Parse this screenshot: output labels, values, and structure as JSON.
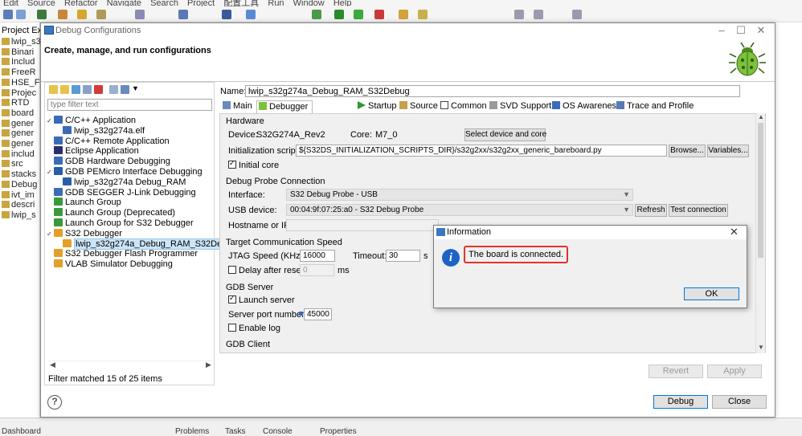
{
  "ide": {
    "menu": [
      "Edit",
      "Source",
      "Refactor",
      "Navigate",
      "Search",
      "Project",
      "配置工具",
      "Run",
      "Window",
      "Help"
    ],
    "project_explorer": {
      "title": "Project Exp",
      "items": [
        "lwip_s32g",
        "Binari",
        "Includ",
        "FreeR",
        "HSE_F",
        "Projec",
        "RTD",
        "board",
        "gener",
        "gener",
        "gener",
        "includ",
        "src",
        "stacks",
        "Debug",
        "ivt_im",
        "descri",
        "lwip_s"
      ]
    },
    "bottom_tabs": [
      "Dashboard",
      "Problems",
      "Tasks",
      "Console",
      "Properties"
    ]
  },
  "dialog": {
    "title": "Debug Configurations",
    "header": "Create, manage, and run configurations",
    "filter_placeholder": "type filter text",
    "tree": [
      {
        "label": "C/C++ Application",
        "level": 0,
        "expanded": true,
        "icon": "c-app-icon",
        "color": "#3b6bb5"
      },
      {
        "label": "lwip_s32g274a.elf",
        "level": 1,
        "icon": "c-file-icon",
        "color": "#3b6bb5"
      },
      {
        "label": "C/C++ Remote Application",
        "level": 0,
        "icon": "c-remote-icon",
        "color": "#3b6bb5"
      },
      {
        "label": "Eclipse Application",
        "level": 0,
        "icon": "eclipse-icon",
        "color": "#2c2c6e"
      },
      {
        "label": "GDB Hardware Debugging",
        "level": 0,
        "icon": "gdb-hw-icon",
        "color": "#3b6bb5"
      },
      {
        "label": "GDB PEMicro Interface Debugging",
        "level": 0,
        "expanded": true,
        "icon": "pemicro-icon",
        "color": "#2a5da8"
      },
      {
        "label": "lwip_s32g274a Debug_RAM",
        "level": 1,
        "icon": "pemicro-config-icon",
        "color": "#2a5da8"
      },
      {
        "label": "GDB SEGGER J-Link Debugging",
        "level": 0,
        "icon": "jlink-icon",
        "color": "#3b6bb5"
      },
      {
        "label": "Launch Group",
        "level": 0,
        "icon": "launch-group-icon",
        "color": "#3a9a3a"
      },
      {
        "label": "Launch Group (Deprecated)",
        "level": 0,
        "icon": "launch-group-deprecated-icon",
        "color": "#3a9a3a"
      },
      {
        "label": "Launch Group for S32 Debugger",
        "level": 0,
        "icon": "launch-group-s32-icon",
        "color": "#3a9a3a"
      },
      {
        "label": "S32 Debugger",
        "level": 0,
        "expanded": true,
        "icon": "s32-debugger-icon",
        "color": "#e2a02a"
      },
      {
        "label": "lwip_s32g274a_Debug_RAM_S32Debug",
        "level": 1,
        "selected": true,
        "icon": "s32-config-icon",
        "color": "#e2a02a"
      },
      {
        "label": "S32 Debugger Flash Programmer",
        "level": 0,
        "icon": "s32-flash-icon",
        "color": "#e2a02a"
      },
      {
        "label": "VLAB Simulator Debugging",
        "level": 0,
        "icon": "vlab-icon",
        "color": "#e2a02a"
      }
    ],
    "filter_status": "Filter matched 15 of 25 items",
    "name_label": "Name:",
    "name_value": "lwip_s32g274a_Debug_RAM_S32Debug",
    "tabs": [
      "Main",
      "Debugger",
      "Startup",
      "Source",
      "Common",
      "SVD Support",
      "OS Awareness",
      "Trace and Profile"
    ],
    "active_tab": "Debugger",
    "debugger": {
      "hardware_title": "Hardware",
      "device_label": "Device:",
      "device_value": "S32G274A_Rev2",
      "core_label": "Core:",
      "core_value": "M7_0",
      "select_device_btn": "Select device and core",
      "init_script_label": "Initialization script:",
      "init_script_value": "${S32DS_INITIALIZATION_SCRIPTS_DIR}/s32g2xx/s32g2xx_generic_bareboard.py",
      "browse_btn": "Browse...",
      "variables_btn": "Variables...",
      "initial_core_label": "Initial core",
      "initial_core_checked": true,
      "probe_title": "Debug Probe Connection",
      "interface_label": "Interface:",
      "interface_value": "S32 Debug Probe - USB",
      "usb_label": "USB device:",
      "usb_value": "00:04:9f:07:25:a0 - S32 Debug Probe",
      "refresh_btn": "Refresh",
      "test_conn_btn": "Test connection",
      "hostname_label": "Hostname or IP:",
      "speed_title": "Target Communication Speed",
      "jtag_label": "JTAG Speed (KHz):",
      "jtag_value": "16000",
      "timeout_label": "Timeout:",
      "timeout_value": "30",
      "timeout_unit": "s",
      "delay_label": "Delay after reset:",
      "delay_value": "0",
      "delay_unit": "ms",
      "delay_checked": false,
      "gdb_server_title": "GDB Server",
      "launch_server_label": "Launch server",
      "launch_server_checked": true,
      "port_label": "Server port number:",
      "port_value": "45000",
      "enable_log_label": "Enable log",
      "enable_log_checked": false,
      "gdb_client_title": "GDB Client"
    },
    "revert_btn": "Revert",
    "apply_btn": "Apply",
    "debug_btn": "Debug",
    "close_btn": "Close",
    "help_glyph": "?"
  },
  "info_dialog": {
    "title": "Information",
    "message": "The board is connected.",
    "ok_btn": "OK",
    "icon_glyph": "i",
    "highlight_color": "#e0342e"
  }
}
